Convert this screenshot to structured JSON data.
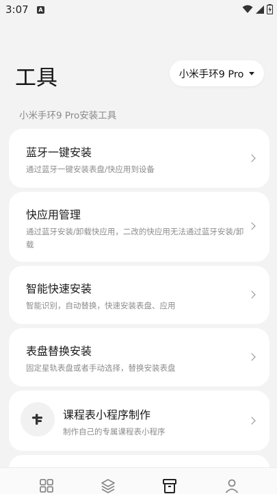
{
  "status": {
    "time": "3:07",
    "notification_badge": "A"
  },
  "header": {
    "title": "工具",
    "device_selector": "小米手环9 Pro"
  },
  "section": {
    "label": "小米手环9 Pro安装工具"
  },
  "tools": [
    {
      "title": "蓝牙一键安装",
      "desc": "通过蓝牙一键安装表盘/快应用到设备"
    },
    {
      "title": "快应用管理",
      "desc": "通过蓝牙安装/卸载快应用，二改的快应用无法通过蓝牙安装/卸载"
    },
    {
      "title": "智能快速安装",
      "desc": "智能识别，自动替换，快速安装表盘、应用"
    },
    {
      "title": "表盘替换安装",
      "desc": "固定星轨表盘或者手动选择，替换安装表盘"
    },
    {
      "title": "课程表小程序制作",
      "desc": "制作自己的专属课程表小程序",
      "icon": "course-table-icon"
    }
  ],
  "bottom_nav": [
    "apps-icon",
    "layers-icon",
    "toolbox-icon",
    "profile-icon"
  ],
  "colors": {
    "background": "#f3f3f3",
    "card": "#ffffff",
    "text_secondary": "#8c8c8c"
  }
}
